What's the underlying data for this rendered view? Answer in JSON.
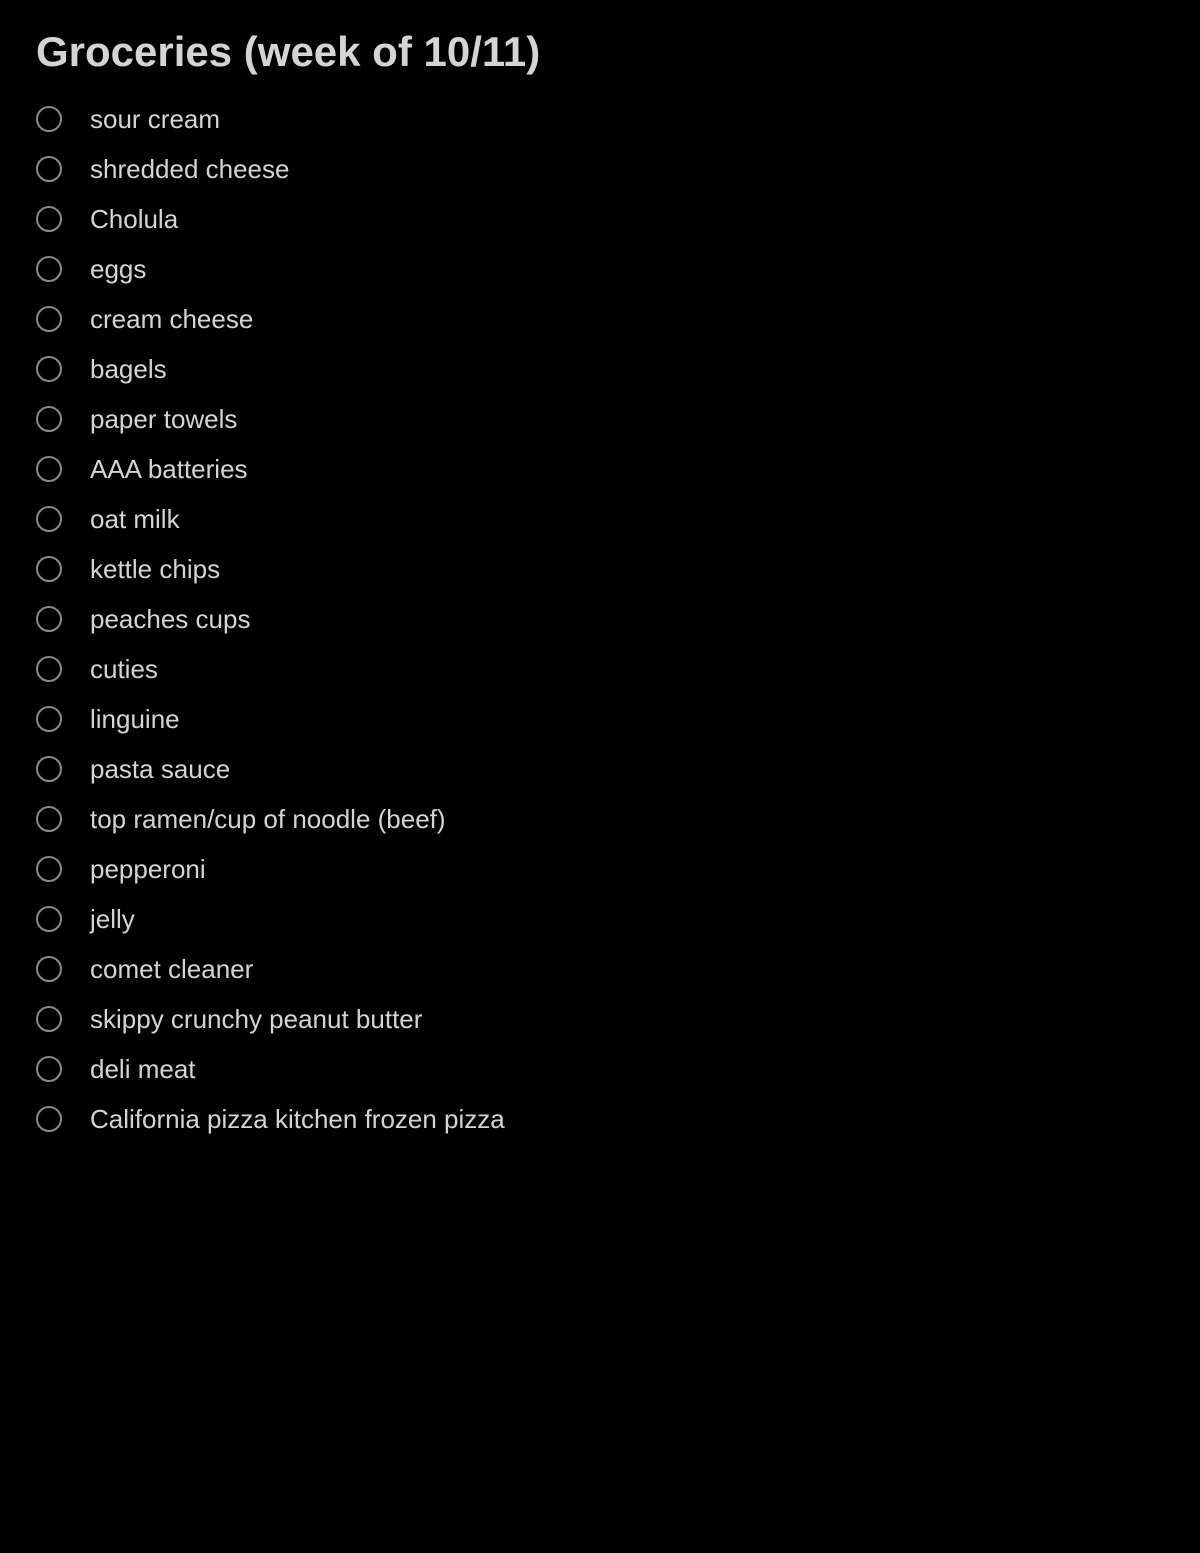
{
  "title": "Groceries (week of 10/11)",
  "items": [
    {
      "label": "sour cream"
    },
    {
      "label": "shredded cheese"
    },
    {
      "label": "Cholula"
    },
    {
      "label": "eggs"
    },
    {
      "label": "cream cheese"
    },
    {
      "label": "bagels"
    },
    {
      "label": "paper towels"
    },
    {
      "label": "AAA batteries"
    },
    {
      "label": "oat milk"
    },
    {
      "label": "kettle chips"
    },
    {
      "label": " peaches cups"
    },
    {
      "label": "cuties"
    },
    {
      "label": "linguine"
    },
    {
      "label": "pasta sauce"
    },
    {
      "label": "top ramen/cup of noodle (beef)"
    },
    {
      "label": "pepperoni"
    },
    {
      "label": "jelly"
    },
    {
      "label": "comet cleaner"
    },
    {
      "label": "skippy crunchy peanut butter"
    },
    {
      "label": "deli meat"
    },
    {
      "label": "California pizza kitchen frozen pizza"
    }
  ]
}
